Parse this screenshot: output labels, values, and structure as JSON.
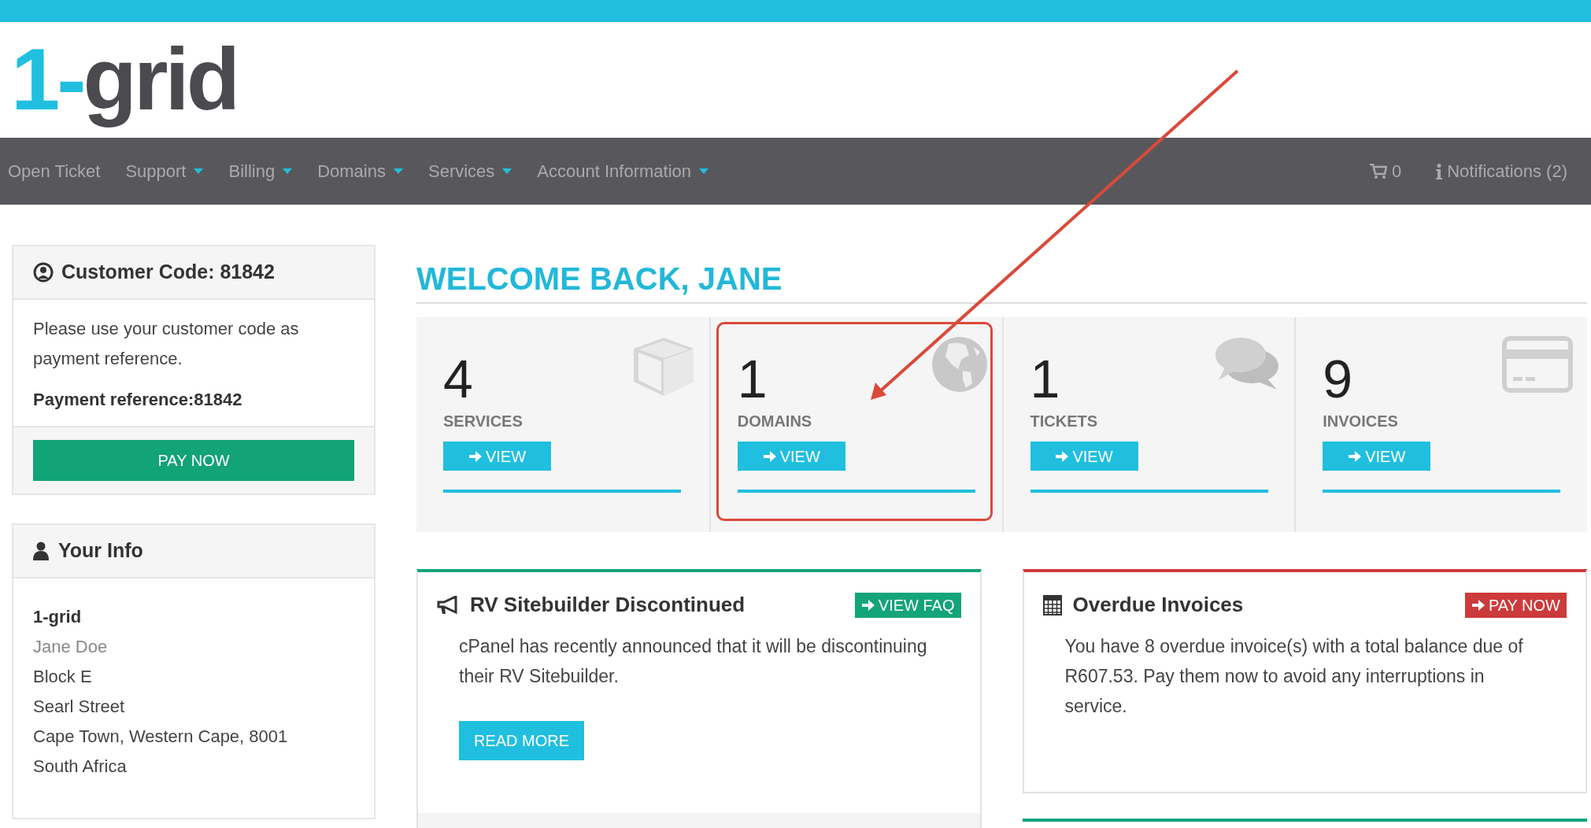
{
  "logo": {
    "parts": [
      "1-",
      "grid"
    ]
  },
  "nav": {
    "items": [
      {
        "label": "Open Ticket",
        "dropdown": false
      },
      {
        "label": "Support",
        "dropdown": true
      },
      {
        "label": "Billing",
        "dropdown": true
      },
      {
        "label": "Domains",
        "dropdown": true
      },
      {
        "label": "Services",
        "dropdown": true
      },
      {
        "label": "Account Information",
        "dropdown": true
      }
    ],
    "cart_count": "0",
    "notifications": "Notifications (2)"
  },
  "customer_card": {
    "title": "Customer Code: 81842",
    "note": "Please use your customer code as payment reference.",
    "reference": "Payment reference:81842",
    "button": "PAY NOW"
  },
  "info_card": {
    "title": "Your Info",
    "lines": [
      {
        "text": "1-grid",
        "kind": "company"
      },
      {
        "text": "Jane Doe",
        "kind": "name"
      },
      {
        "text": "Block E",
        "kind": "address"
      },
      {
        "text": "Searl Street",
        "kind": "address"
      },
      {
        "text": "Cape Town, Western Cape, 8001",
        "kind": "address"
      },
      {
        "text": "South Africa",
        "kind": "address"
      }
    ]
  },
  "welcome": "WELCOME BACK, JANE",
  "tiles": [
    {
      "count": "4",
      "label": "SERVICES",
      "button": "VIEW",
      "highlighted": false
    },
    {
      "count": "1",
      "label": "DOMAINS",
      "button": "VIEW",
      "highlighted": true
    },
    {
      "count": "1",
      "label": "TICKETS",
      "button": "VIEW",
      "highlighted": false
    },
    {
      "count": "9",
      "label": "INVOICES",
      "button": "VIEW",
      "highlighted": false
    }
  ],
  "panels": [
    {
      "title": "RV Sitebuilder Discontinued",
      "color": "#13a47a",
      "action": "VIEW FAQ",
      "body": "cPanel has recently announced that it will be discontinuing their RV Sitebuilder.",
      "button": "READ MORE"
    },
    {
      "title": "Overdue Invoices",
      "color": "#cc3b3b",
      "action": "PAY NOW",
      "body": "You have 8 overdue invoice(s) with a total balance due of R607.53. Pay them now to avoid any interruptions in service."
    }
  ]
}
